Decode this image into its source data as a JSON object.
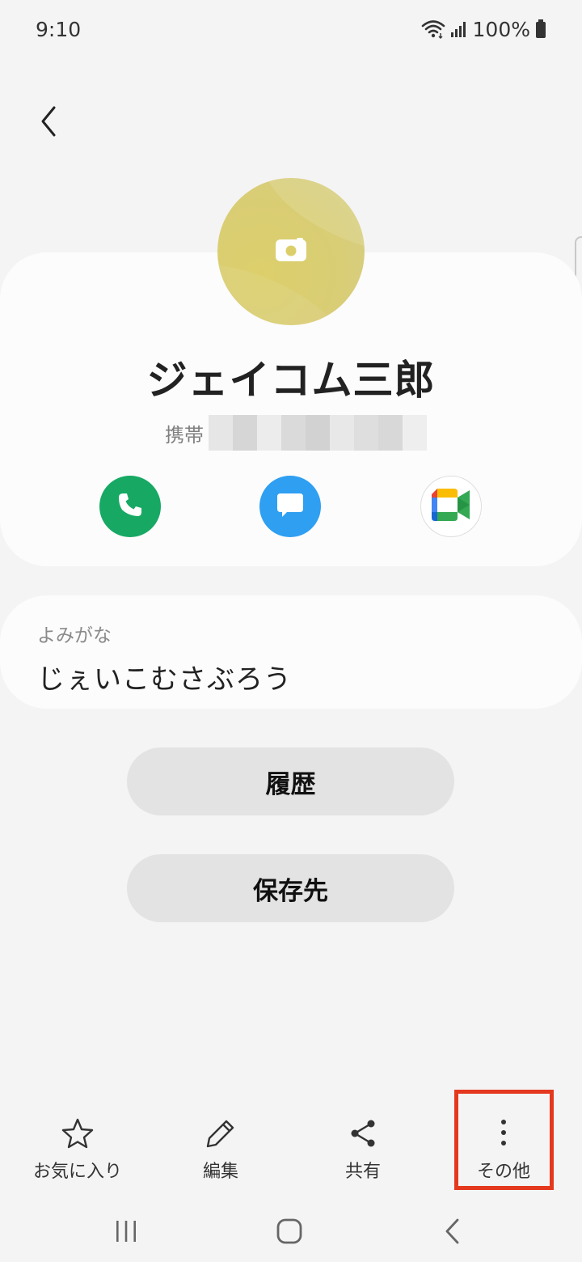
{
  "status_bar": {
    "time": "9:10",
    "battery": "100%",
    "icons": [
      "wifi-icon",
      "signal-icon",
      "battery-icon"
    ]
  },
  "header": {
    "back_icon": "chevron-left-icon"
  },
  "contact": {
    "name": "ジェイコム三郎",
    "phone_label": "携帯",
    "avatar_color": "#dccf6b",
    "avatar_icon": "camera-icon",
    "actions": [
      {
        "name": "call",
        "icon": "phone-icon",
        "color": "#17a964"
      },
      {
        "name": "message",
        "icon": "chat-bubble-icon",
        "color": "#2f9ff2"
      },
      {
        "name": "video",
        "icon": "google-meet-icon",
        "color": "#ffffff"
      }
    ]
  },
  "reading": {
    "label": "よみがな",
    "value": "じぇいこむさぶろう"
  },
  "buttons": {
    "history": "履歴",
    "storage": "保存先"
  },
  "toolbar": {
    "favorite": "お気に入り",
    "edit": "編集",
    "share": "共有",
    "more": "その他",
    "highlight_color": "#e5391f"
  },
  "nav": {
    "icons": [
      "recent-apps-icon",
      "home-icon",
      "back-icon"
    ]
  }
}
